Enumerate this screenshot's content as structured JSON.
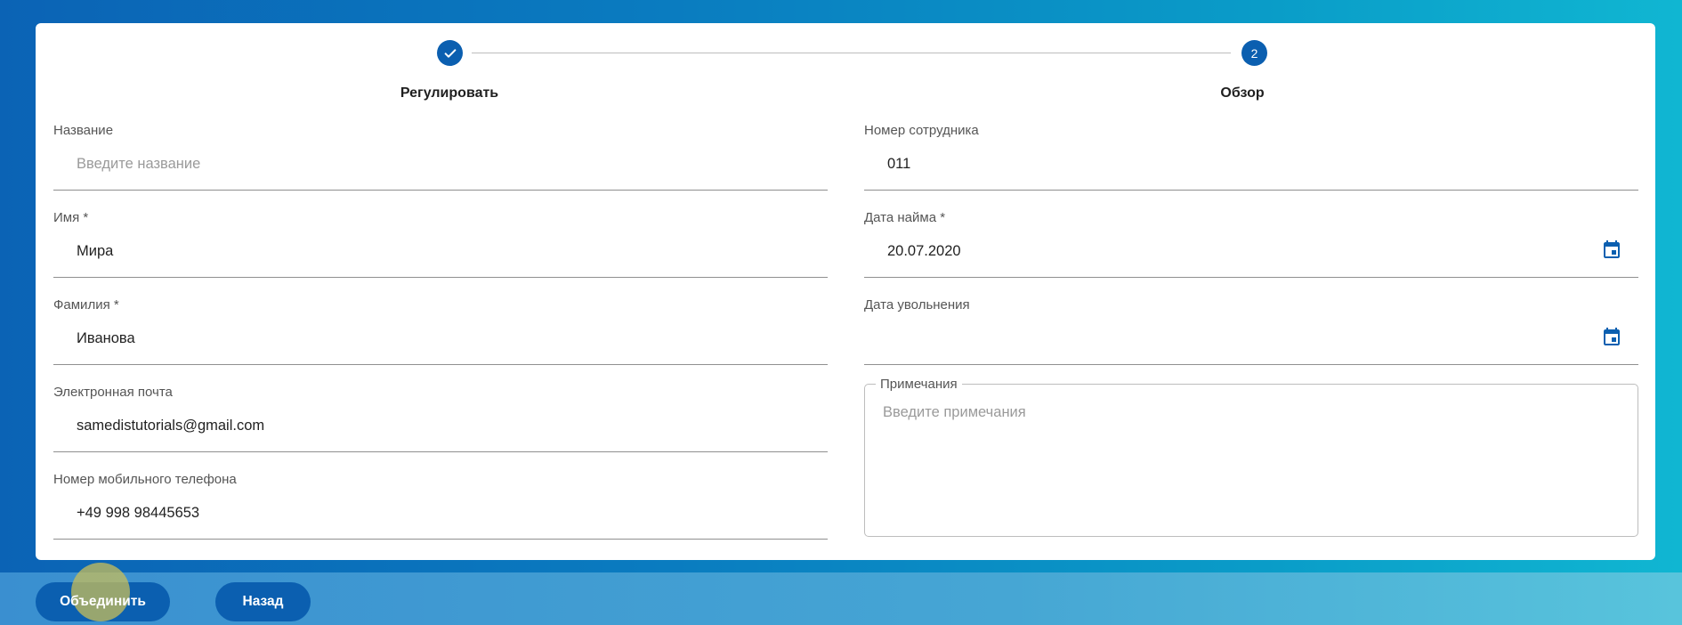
{
  "stepper": {
    "steps": [
      {
        "label": "Регулировать",
        "indicator": "✓",
        "state": "completed"
      },
      {
        "label": "Обзор",
        "indicator": "2",
        "state": "active"
      }
    ]
  },
  "form": {
    "title_field": {
      "label": "Название",
      "value": "",
      "placeholder": "Введите название"
    },
    "first_name": {
      "label": "Имя *",
      "value": "Мира"
    },
    "last_name": {
      "label": "Фамилия *",
      "value": "Иванова"
    },
    "email": {
      "label": "Электронная почта",
      "value": "samedistutorials@gmail.com"
    },
    "mobile": {
      "label": "Номер мобильного телефона",
      "value": "+49 998 98445653"
    },
    "employee_number": {
      "label": "Номер сотрудника",
      "value": "011"
    },
    "hire_date": {
      "label": "Дата найма *",
      "value": "20.07.2020"
    },
    "termination_date": {
      "label": "Дата увольнения",
      "value": ""
    },
    "notes": {
      "label": "Примечания",
      "value": "",
      "placeholder": "Введите примечания"
    }
  },
  "footer": {
    "merge_label": "Объединить",
    "back_label": "Назад"
  },
  "colors": {
    "accent": "#0b5fb0",
    "card": "#ffffff"
  },
  "icons": {
    "calendar": "calendar-icon",
    "check": "check-icon"
  }
}
